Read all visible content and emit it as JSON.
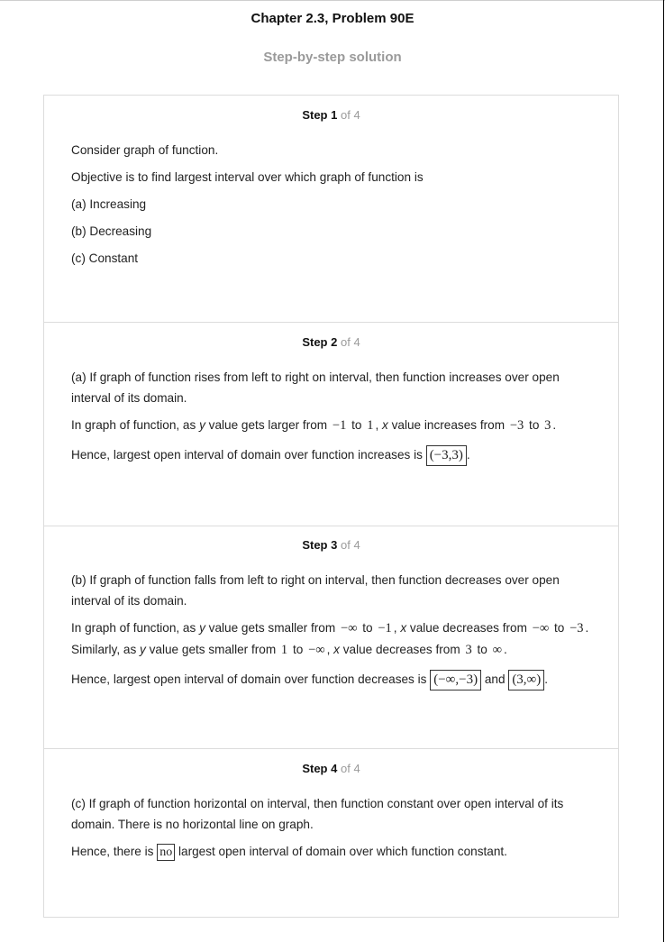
{
  "chapter_title": "Chapter 2.3, Problem 90E",
  "subtitle": "Step-by-step solution",
  "step_word": "Step",
  "steps": [
    {
      "number": "1",
      "of_total": "of 4",
      "lines": {
        "l1": "Consider graph of function.",
        "l2": "Objective is to find largest interval over which graph of function is",
        "l3": "(a) Increasing",
        "l4": "(b) Decreasing",
        "l5": "(c) Constant"
      }
    },
    {
      "number": "2",
      "of_total": "of 4",
      "lines": {
        "p1": "(a) If graph of function rises from left to right on interval, then function increases over open interval of its domain.",
        "p2_a": "In graph of function, as ",
        "p2_y": "y",
        "p2_b": " value gets larger from ",
        "p2_m1": "−1",
        "p2_c": " to ",
        "p2_m2": "1",
        "p2_d": ", ",
        "p2_x": "x",
        "p2_e": " value increases from ",
        "p2_m3": "−3",
        "p2_f": " to ",
        "p2_m4": "3",
        "p2_g": ".",
        "p3_a": "Hence, largest open interval of domain over function increases is ",
        "p3_box": "(−3,3)",
        "p3_b": "."
      }
    },
    {
      "number": "3",
      "of_total": "of 4",
      "lines": {
        "p1": "(b) If graph of function falls from left to right on interval, then function decreases over open interval of its domain.",
        "p2_a": "In graph of function, as ",
        "p2_y": "y",
        "p2_b": " value gets smaller from ",
        "p2_m1": "−∞",
        "p2_c": " to ",
        "p2_m2": "−1",
        "p2_d": ", ",
        "p2_x": "x",
        "p2_e": " value decreases from ",
        "p2_m3": "−∞",
        "p2_f": " to ",
        "p2_m4": "−3",
        "p2_g": ". Similarly, as ",
        "p2_y2": "y",
        "p2_h": " value gets smaller from ",
        "p2_m5": "1",
        "p2_i": " to ",
        "p2_m6": "−∞",
        "p2_j": ", ",
        "p2_x2": "x",
        "p2_k": " value decreases from ",
        "p2_m7": "3",
        "p2_l": " to ",
        "p2_m8": "∞",
        "p2_m": ".",
        "p3_a": "Hence, largest open interval of domain over function decreases is ",
        "p3_box1": "(−∞,−3)",
        "p3_and": " and ",
        "p3_box2": "(3,∞)",
        "p3_b": "."
      }
    },
    {
      "number": "4",
      "of_total": "of 4",
      "lines": {
        "p1": "(c) If graph of function horizontal on interval, then function constant over open interval of its domain. There is no horizontal line on graph.",
        "p2_a": "Hence, there is ",
        "p2_box": "no",
        "p2_b": " largest open interval of domain over which function constant."
      }
    }
  ]
}
